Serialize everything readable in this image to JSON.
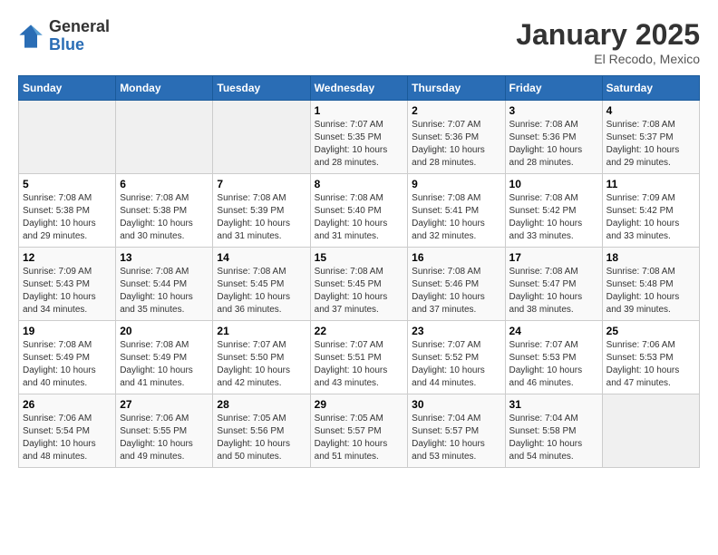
{
  "header": {
    "logo_general": "General",
    "logo_blue": "Blue",
    "month_title": "January 2025",
    "location": "El Recodo, Mexico"
  },
  "days_of_week": [
    "Sunday",
    "Monday",
    "Tuesday",
    "Wednesday",
    "Thursday",
    "Friday",
    "Saturday"
  ],
  "weeks": [
    [
      {
        "day": "",
        "info": ""
      },
      {
        "day": "",
        "info": ""
      },
      {
        "day": "",
        "info": ""
      },
      {
        "day": "1",
        "info": "Sunrise: 7:07 AM\nSunset: 5:35 PM\nDaylight: 10 hours\nand 28 minutes."
      },
      {
        "day": "2",
        "info": "Sunrise: 7:07 AM\nSunset: 5:36 PM\nDaylight: 10 hours\nand 28 minutes."
      },
      {
        "day": "3",
        "info": "Sunrise: 7:08 AM\nSunset: 5:36 PM\nDaylight: 10 hours\nand 28 minutes."
      },
      {
        "day": "4",
        "info": "Sunrise: 7:08 AM\nSunset: 5:37 PM\nDaylight: 10 hours\nand 29 minutes."
      }
    ],
    [
      {
        "day": "5",
        "info": "Sunrise: 7:08 AM\nSunset: 5:38 PM\nDaylight: 10 hours\nand 29 minutes."
      },
      {
        "day": "6",
        "info": "Sunrise: 7:08 AM\nSunset: 5:38 PM\nDaylight: 10 hours\nand 30 minutes."
      },
      {
        "day": "7",
        "info": "Sunrise: 7:08 AM\nSunset: 5:39 PM\nDaylight: 10 hours\nand 31 minutes."
      },
      {
        "day": "8",
        "info": "Sunrise: 7:08 AM\nSunset: 5:40 PM\nDaylight: 10 hours\nand 31 minutes."
      },
      {
        "day": "9",
        "info": "Sunrise: 7:08 AM\nSunset: 5:41 PM\nDaylight: 10 hours\nand 32 minutes."
      },
      {
        "day": "10",
        "info": "Sunrise: 7:08 AM\nSunset: 5:42 PM\nDaylight: 10 hours\nand 33 minutes."
      },
      {
        "day": "11",
        "info": "Sunrise: 7:09 AM\nSunset: 5:42 PM\nDaylight: 10 hours\nand 33 minutes."
      }
    ],
    [
      {
        "day": "12",
        "info": "Sunrise: 7:09 AM\nSunset: 5:43 PM\nDaylight: 10 hours\nand 34 minutes."
      },
      {
        "day": "13",
        "info": "Sunrise: 7:08 AM\nSunset: 5:44 PM\nDaylight: 10 hours\nand 35 minutes."
      },
      {
        "day": "14",
        "info": "Sunrise: 7:08 AM\nSunset: 5:45 PM\nDaylight: 10 hours\nand 36 minutes."
      },
      {
        "day": "15",
        "info": "Sunrise: 7:08 AM\nSunset: 5:45 PM\nDaylight: 10 hours\nand 37 minutes."
      },
      {
        "day": "16",
        "info": "Sunrise: 7:08 AM\nSunset: 5:46 PM\nDaylight: 10 hours\nand 37 minutes."
      },
      {
        "day": "17",
        "info": "Sunrise: 7:08 AM\nSunset: 5:47 PM\nDaylight: 10 hours\nand 38 minutes."
      },
      {
        "day": "18",
        "info": "Sunrise: 7:08 AM\nSunset: 5:48 PM\nDaylight: 10 hours\nand 39 minutes."
      }
    ],
    [
      {
        "day": "19",
        "info": "Sunrise: 7:08 AM\nSunset: 5:49 PM\nDaylight: 10 hours\nand 40 minutes."
      },
      {
        "day": "20",
        "info": "Sunrise: 7:08 AM\nSunset: 5:49 PM\nDaylight: 10 hours\nand 41 minutes."
      },
      {
        "day": "21",
        "info": "Sunrise: 7:07 AM\nSunset: 5:50 PM\nDaylight: 10 hours\nand 42 minutes."
      },
      {
        "day": "22",
        "info": "Sunrise: 7:07 AM\nSunset: 5:51 PM\nDaylight: 10 hours\nand 43 minutes."
      },
      {
        "day": "23",
        "info": "Sunrise: 7:07 AM\nSunset: 5:52 PM\nDaylight: 10 hours\nand 44 minutes."
      },
      {
        "day": "24",
        "info": "Sunrise: 7:07 AM\nSunset: 5:53 PM\nDaylight: 10 hours\nand 46 minutes."
      },
      {
        "day": "25",
        "info": "Sunrise: 7:06 AM\nSunset: 5:53 PM\nDaylight: 10 hours\nand 47 minutes."
      }
    ],
    [
      {
        "day": "26",
        "info": "Sunrise: 7:06 AM\nSunset: 5:54 PM\nDaylight: 10 hours\nand 48 minutes."
      },
      {
        "day": "27",
        "info": "Sunrise: 7:06 AM\nSunset: 5:55 PM\nDaylight: 10 hours\nand 49 minutes."
      },
      {
        "day": "28",
        "info": "Sunrise: 7:05 AM\nSunset: 5:56 PM\nDaylight: 10 hours\nand 50 minutes."
      },
      {
        "day": "29",
        "info": "Sunrise: 7:05 AM\nSunset: 5:57 PM\nDaylight: 10 hours\nand 51 minutes."
      },
      {
        "day": "30",
        "info": "Sunrise: 7:04 AM\nSunset: 5:57 PM\nDaylight: 10 hours\nand 53 minutes."
      },
      {
        "day": "31",
        "info": "Sunrise: 7:04 AM\nSunset: 5:58 PM\nDaylight: 10 hours\nand 54 minutes."
      },
      {
        "day": "",
        "info": ""
      }
    ]
  ]
}
